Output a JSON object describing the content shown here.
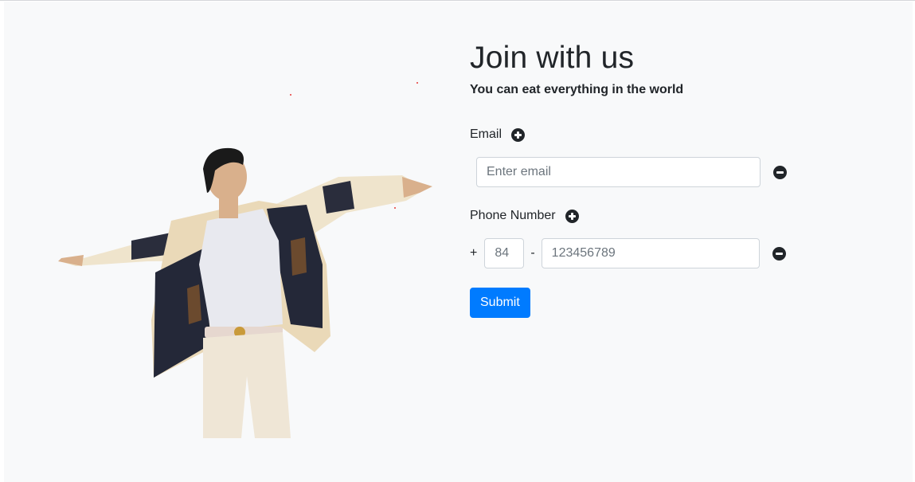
{
  "heading": {
    "title": "Join with us",
    "subtitle": "You can eat everything in the world"
  },
  "email": {
    "label": "Email",
    "add_icon": "plus-circle-icon",
    "input_value": "",
    "input_placeholder": "Enter email",
    "remove_icon": "minus-circle-icon"
  },
  "phone": {
    "label": "Phone Number",
    "add_icon": "plus-circle-icon",
    "prefix": "+",
    "code_value": "",
    "code_placeholder": "84",
    "separator": "-",
    "number_value": "",
    "number_placeholder": "123456789",
    "remove_icon": "minus-circle-icon"
  },
  "submit_label": "Submit",
  "hero_image": "person-in-jacket-arms-outstretched",
  "colors": {
    "primary": "#007bff",
    "background": "#f8f9fa",
    "text": "#212529",
    "icon": "#212529"
  }
}
